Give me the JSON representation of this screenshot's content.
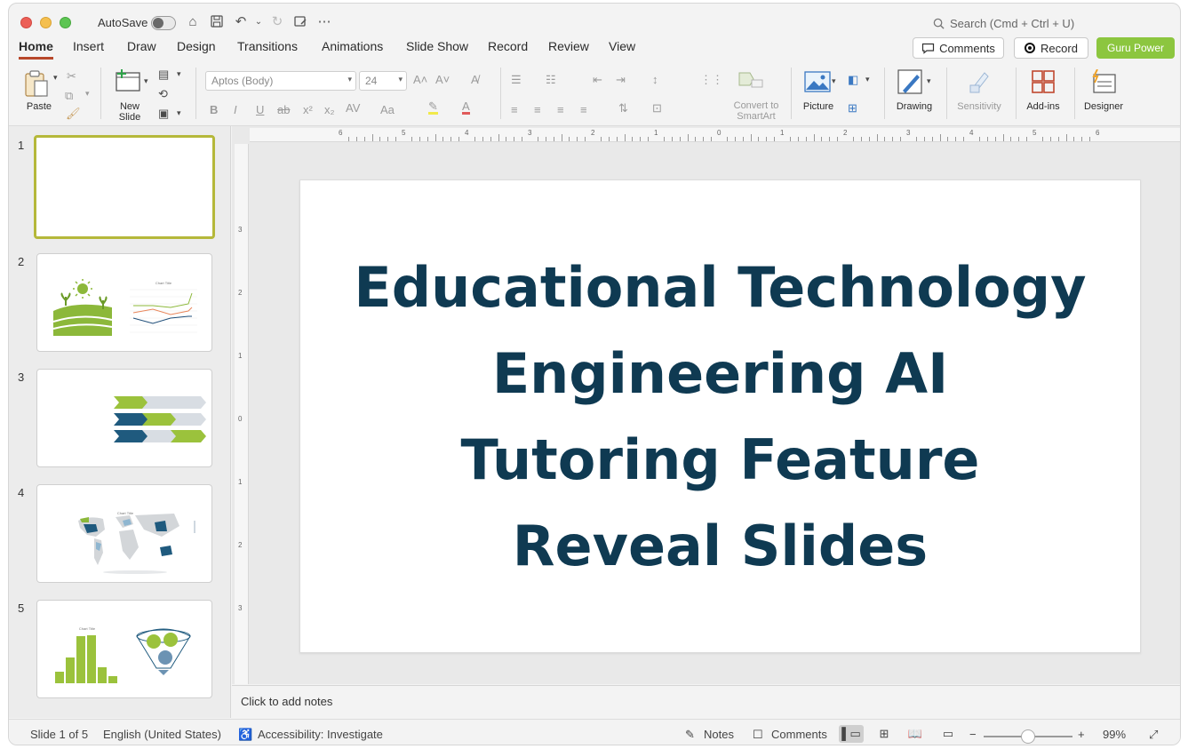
{
  "titlebar": {
    "autosave_label": "AutoSave",
    "search_placeholder": "Search (Cmd + Ctrl + U)"
  },
  "tabs": [
    "Home",
    "Insert",
    "Draw",
    "Design",
    "Transitions",
    "Animations",
    "Slide Show",
    "Record",
    "Review",
    "View"
  ],
  "active_tab": "Home",
  "buttons": {
    "comments": "Comments",
    "record": "Record",
    "guru": "Guru Power"
  },
  "ribbon": {
    "paste": "Paste",
    "new_slide": "New Slide",
    "font_name": "Aptos (Body)",
    "font_size": "24",
    "convert_smartart": "Convert to SmartArt",
    "picture": "Picture",
    "drawing": "Drawing",
    "sensitivity": "Sensitivity",
    "addins": "Add-ins",
    "designer": "Designer"
  },
  "slides": [
    {
      "number": "1"
    },
    {
      "number": "2",
      "thumb_title": "Chart Title"
    },
    {
      "number": "3"
    },
    {
      "number": "4",
      "thumb_title": "Chart Title"
    },
    {
      "number": "5",
      "thumb_title": "Chart Title"
    }
  ],
  "slide_title_lines": [
    "Educational Technology",
    "Engineering AI",
    "Tutoring Feature",
    "Reveal Slides"
  ],
  "notes_placeholder": "Click to add notes",
  "status": {
    "slide_counter": "Slide 1 of 5",
    "language": "English (United States)",
    "accessibility": "Accessibility: Investigate",
    "notes": "Notes",
    "comments": "Comments",
    "zoom": "99%"
  },
  "ruler": {
    "h_ticks": [
      "6",
      "5",
      "4",
      "3",
      "2",
      "1",
      "0",
      "1",
      "2",
      "3",
      "4",
      "5",
      "6"
    ],
    "v_ticks": [
      "3",
      "2",
      "1",
      "0",
      "1",
      "2",
      "3"
    ]
  },
  "colors": {
    "title_color": "#0f3a52",
    "accent_green": "#8cc63f",
    "selected_thumb_border": "#b5b83a",
    "active_tab_underline": "#b7472a"
  }
}
